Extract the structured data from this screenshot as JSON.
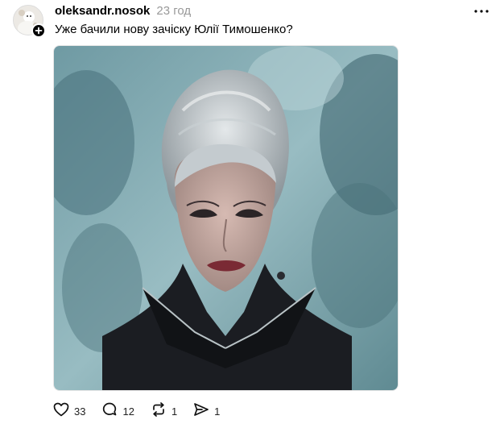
{
  "post": {
    "username": "oleksandr.nosok",
    "time": "23 год",
    "caption": "Уже бачили нову зачіску Юлії Тимошенко?",
    "media_icon": "photo-image"
  },
  "avatar": {
    "icon": "user-avatar",
    "badge_icon": "plus-icon"
  },
  "actions": {
    "like_count": "33",
    "comment_count": "12",
    "repost_count": "1",
    "share_count": "1"
  },
  "colors": {
    "accent": "#000000",
    "muted": "#999999",
    "border": "#e6e6e6"
  }
}
